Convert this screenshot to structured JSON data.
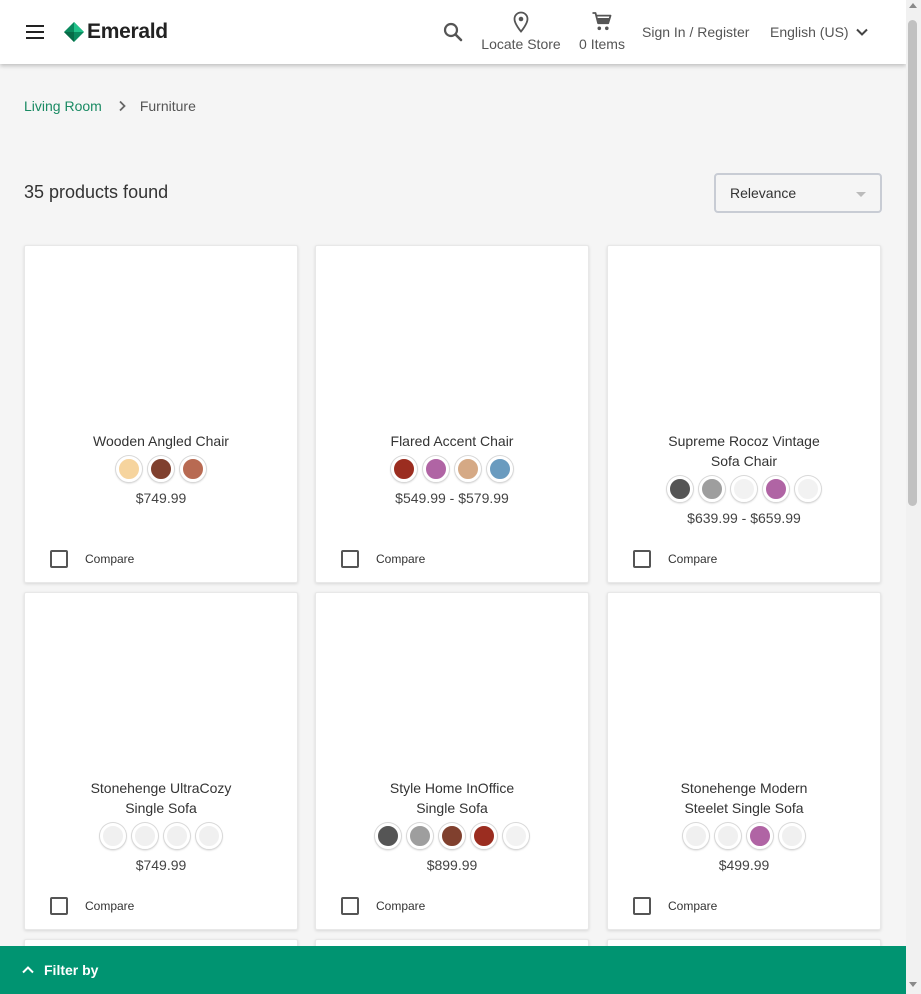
{
  "header": {
    "brand": "Emerald",
    "locate_label": "Locate Store",
    "cart_label": "0 Items",
    "signin_label": "Sign In / Register",
    "language_label": "English (US)"
  },
  "breadcrumb": {
    "parent": "Living Room",
    "current": "Furniture"
  },
  "results": {
    "count_text": "35 products found",
    "sort_value": "Relevance"
  },
  "compare_label": "Compare",
  "products": [
    {
      "name": [
        "Wooden Angled Chair"
      ],
      "price": "$749.99",
      "swatches": [
        "#f6d49e",
        "#80402e",
        "#b86a52"
      ]
    },
    {
      "name": [
        "Flared Accent Chair"
      ],
      "price": "$549.99 - $579.99",
      "swatches": [
        "#9b2d20",
        "#b064a4",
        "#d5a985",
        "#6a9bbf"
      ]
    },
    {
      "name": [
        "Supreme Rocoz Vintage",
        "Sofa Chair"
      ],
      "price": "$639.99 - $659.99",
      "swatches": [
        "#555555",
        "#9e9e9e",
        "#f2f2f2",
        "#b064a4",
        "#f2f2f2"
      ]
    },
    {
      "name": [
        "Stonehenge UltraCozy",
        "Single Sofa"
      ],
      "price": "$749.99",
      "swatches": [
        "#f0f0f0",
        "#f0f0f0",
        "#f0f0f0",
        "#f0f0f0"
      ]
    },
    {
      "name": [
        "Style Home InOffice",
        "Single Sofa"
      ],
      "price": "$899.99",
      "swatches": [
        "#555555",
        "#9e9e9e",
        "#80402e",
        "#9b2d20",
        "#f2f2f2"
      ]
    },
    {
      "name": [
        "Stonehenge Modern",
        "Steelet Single Sofa"
      ],
      "price": "$499.99",
      "swatches": [
        "#f0f0f0",
        "#f0f0f0",
        "#b064a4",
        "#f0f0f0"
      ]
    }
  ],
  "filter": {
    "label": "Filter by"
  },
  "colors": {
    "accent": "#009471",
    "link": "#1a8a63"
  }
}
